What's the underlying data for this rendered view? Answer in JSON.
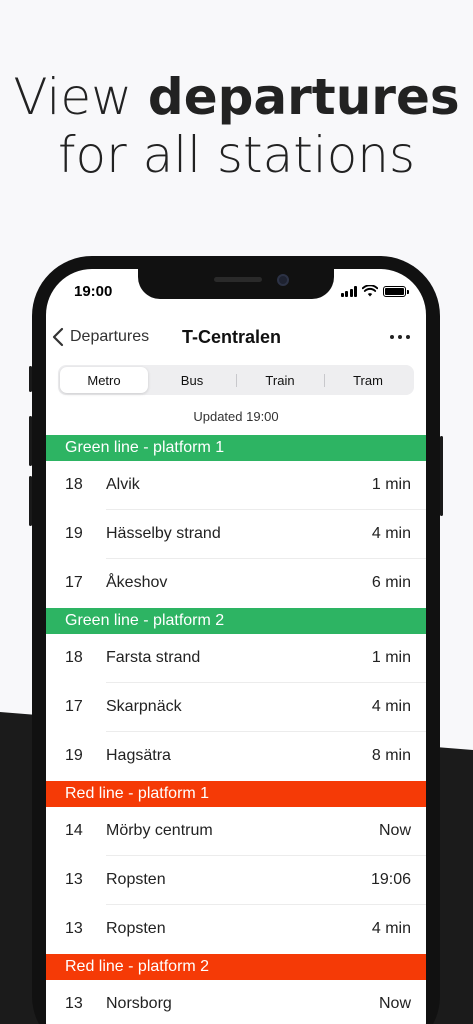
{
  "headline": {
    "before": "View ",
    "bold": "departures",
    "line2": "for all stations"
  },
  "status_bar": {
    "time": "19:00"
  },
  "nav": {
    "back_label": "Departures",
    "title": "T-Centralen"
  },
  "tabs": [
    {
      "label": "Metro",
      "active": true
    },
    {
      "label": "Bus",
      "active": false
    },
    {
      "label": "Train",
      "active": false
    },
    {
      "label": "Tram",
      "active": false
    }
  ],
  "updated_text": "Updated 19:00",
  "colors": {
    "green_line": "#2db463",
    "red_line": "#f53a06",
    "background": "#f8f8fa"
  },
  "groups": [
    {
      "title": "Green line - platform 1",
      "color": "#2db463",
      "departures": [
        {
          "line": "18",
          "destination": "Alvik",
          "time": "1 min"
        },
        {
          "line": "19",
          "destination": "Hässelby strand",
          "time": "4 min"
        },
        {
          "line": "17",
          "destination": "Åkeshov",
          "time": "6 min"
        }
      ]
    },
    {
      "title": "Green line - platform 2",
      "color": "#2db463",
      "departures": [
        {
          "line": "18",
          "destination": "Farsta strand",
          "time": "1 min"
        },
        {
          "line": "17",
          "destination": "Skarpnäck",
          "time": "4 min"
        },
        {
          "line": "19",
          "destination": "Hagsätra",
          "time": "8 min"
        }
      ]
    },
    {
      "title": "Red line - platform 1",
      "color": "#f53a06",
      "departures": [
        {
          "line": "14",
          "destination": "Mörby centrum",
          "time": "Now"
        },
        {
          "line": "13",
          "destination": "Ropsten",
          "time": "19:06"
        },
        {
          "line": "13",
          "destination": "Ropsten",
          "time": "4 min"
        }
      ]
    },
    {
      "title": "Red line - platform 2",
      "color": "#f53a06",
      "departures": [
        {
          "line": "13",
          "destination": "Norsborg",
          "time": "Now"
        }
      ]
    }
  ]
}
